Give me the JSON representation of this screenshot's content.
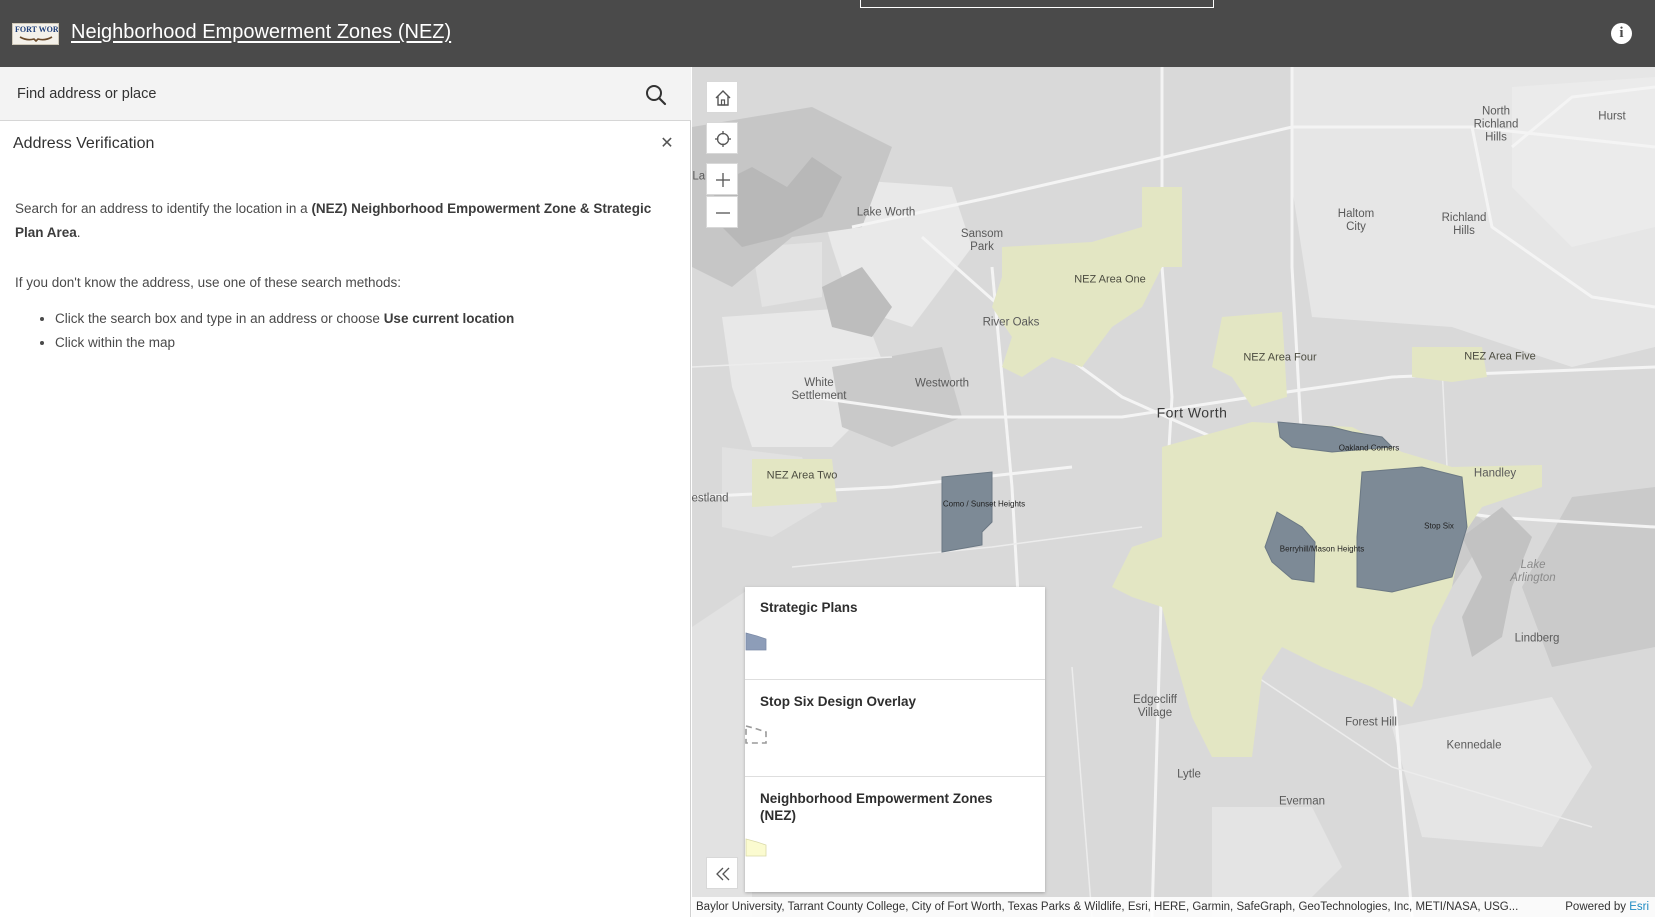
{
  "header": {
    "logo_text": "FORT WORTH",
    "title": "Neighborhood Empowerment Zones (NEZ)",
    "info_icon": "info-icon"
  },
  "search": {
    "placeholder": "Find address or place",
    "icon": "search-icon"
  },
  "panel": {
    "title": "Address Verification",
    "close_icon": "close-icon",
    "intro_pre": "Search for an address to identify the location in a ",
    "intro_bold": "(NEZ) Neighborhood Empowerment Zone & Strategic Plan Area",
    "intro_post": ".",
    "methods_intro": "If you don't know the address, use one of these search methods:",
    "method_1_pre": "Click the search box and type in an address or choose ",
    "method_1_bold": "Use current location",
    "method_2": "Click within the map"
  },
  "map": {
    "tools": [
      "home-icon",
      "locate-icon",
      "zoom-in-icon",
      "zoom-out-icon"
    ],
    "labels": {
      "lake_worth": "Lake Worth",
      "sansom_park": "Sansom\nPark",
      "river_oaks": "River Oaks",
      "white_settlement": "White\nSettlement",
      "westworth": "Westworth",
      "fort_worth": "Fort Worth",
      "north_richland_hills": "North\nRichland\nHills",
      "hurst": "Hurst",
      "haltom_city": "Haltom\nCity",
      "richland_hills": "Richland\nHills",
      "handley": "Handley",
      "lake_arlington": "Lake\nArlington",
      "lindberg": "Lindberg",
      "forest_hill": "Forest Hill",
      "kennedale": "Kennedale",
      "edgecliff_village": "Edgecliff\nVillage",
      "lytle": "Lytle",
      "everman": "Everman",
      "westland": "estland",
      "lak": "Lal",
      "nez_one": "NEZ Area One",
      "nez_two": "NEZ Area Two",
      "nez_four": "NEZ Area Four",
      "nez_five": "NEZ Area Five",
      "oakland_corners": "Oakland Corners",
      "como": "Como / Sunset Heights",
      "berryhill": "Berryhill/Mason Heights",
      "stop_six": "Stop Six"
    },
    "colors": {
      "nez_fill": "#e3e6c3",
      "strategic_fill": "#7d8a96",
      "base": "#dcdcdc"
    }
  },
  "legend": {
    "strategic_plans": "Strategic Plans",
    "stop_six_overlay": "Stop Six Design Overlay",
    "nez": "Neighborhood Empowerment Zones\n(NEZ)",
    "collapse_icon": "double-chevron-left-icon"
  },
  "attribution": {
    "text": "Baylor University, Tarrant County College, City of Fort Worth, Texas Parks & Wildlife, Esri, HERE, Garmin, SafeGraph, GeoTechnologies, Inc, METI/NASA, USG...",
    "powered_by": "Powered by ",
    "esri": "Esri"
  }
}
